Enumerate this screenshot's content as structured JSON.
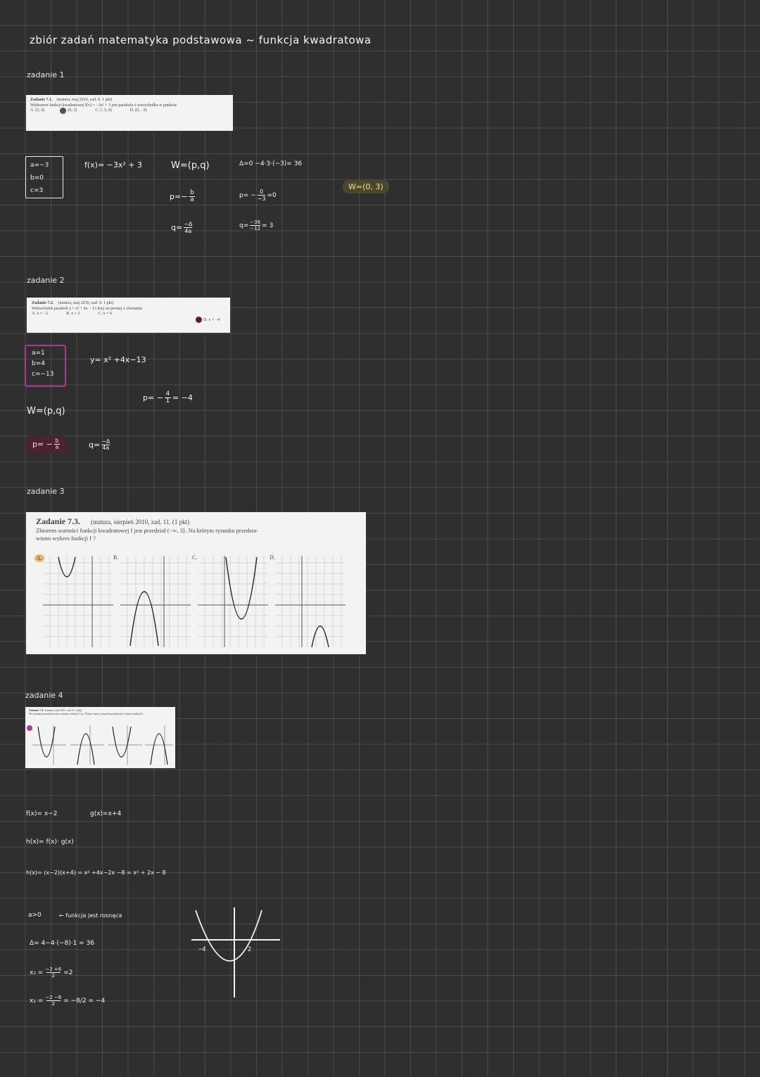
{
  "title": "zbiór zadań matematyka podstawowa ~ funkcja kwadratowa",
  "task1": {
    "label": "zadanie 1",
    "card": {
      "heading": "Zadanie 7.1.",
      "source": "(matura, maj 2010, zad. 8. 1 pkt)",
      "text": "Wykresem funkcji kwadratowej f(x) = −3x² + 3 jest parabola o wierzchołku w punkcie",
      "options": [
        "A. (3, 0)",
        "B. (0, 3)",
        "C. (−3, 0)",
        "D. (0, −3)"
      ]
    },
    "coeffs": [
      "a=−3",
      "b=0",
      "c=3"
    ],
    "func": "f(x)= −3x² + 3",
    "vertex": "W=(p,q)",
    "p_formula_left": "p=−",
    "p_formula_num": "b",
    "p_formula_den": "a",
    "q_formula_left": "q=",
    "q_formula_num": "−Δ",
    "q_formula_den": "4a",
    "delta": "Δ=0 −4·3·(−3)= 36",
    "p_calc_left": "p= −",
    "p_calc_num": "0",
    "p_calc_den": "−3",
    "p_calc_right": "=0",
    "q_calc_left": "q=",
    "q_calc_num": "−36",
    "q_calc_den": "−12",
    "q_calc_right": "= 3",
    "answer": "W=(0, 3)"
  },
  "task2": {
    "label": "zadanie 2",
    "card": {
      "heading": "Zadanie 7.2.",
      "source": "(matura, maj 2010, zad. 9. 1 pkt)",
      "text": "Wierzchołek paraboli y = x² + 4x − 13 leży na prostej o równaniu",
      "options": [
        "A. x = −2",
        "B. x = 2",
        "C. x = 4",
        "D. x = −4"
      ]
    },
    "coeffs": [
      "a=1",
      "b=4",
      "c=−13"
    ],
    "func": "y= x² +4x−13",
    "p_calc_left": "p= −",
    "p_calc_num": "4",
    "p_calc_den": "1",
    "p_calc_right": "= −4",
    "vertex": "W=(p,q)",
    "p_formula_left": "p= −",
    "p_formula_num": "b",
    "p_formula_den": "a",
    "q_formula_left": "q=",
    "q_formula_num": "−Δ",
    "q_formula_den": "4a"
  },
  "task3": {
    "label": "zadanie 3",
    "card": {
      "heading": "Zadanie 7.3.",
      "source": "(matura, sierpień 2010, zad. 11. (1 pkt)",
      "text1": "Zbiorem wartości funkcji kwadratowej f jest przedział (−∞, 3⟩. Na którym rysunku przedsta-",
      "text2": "wiono wykres funkcji f ?",
      "options": [
        "A.",
        "B.",
        "C.",
        "D."
      ]
    }
  },
  "task4": {
    "label": "zadanie 4",
    "card": {
      "heading": "Zadanie 7.4.",
      "source": "(matura, maj 2011, zad. 8. 1 pkt)",
      "text": "Na rysunku przedstawiono wykresy funkcji f i g. Wskaż, który rysunek przedstawia wykres funkcji h."
    },
    "f": "f(x)= x−2",
    "g": "g(x)=x+4",
    "h": "h(x)= f(x)· g(x)",
    "h_expand": "h(x)= (x−2)(x+4) = x² +4x−2x −8 = x² + 2x − 8",
    "a_pos": "a>0",
    "a_pos_note": "← funkcja jest rosnąca",
    "delta": "Δ= 4−4·(−8)·1 = 36",
    "x1_left": "x₁ =",
    "x1_num": "−2 +6",
    "x1_den": "2",
    "x1_right": "=2",
    "x2_left": "x₂ =",
    "x2_num": "−2 −6",
    "x2_den": "2",
    "x2_right": "= −8/2 = −4",
    "graph_label_left": "−4",
    "graph_label_right": "2"
  }
}
